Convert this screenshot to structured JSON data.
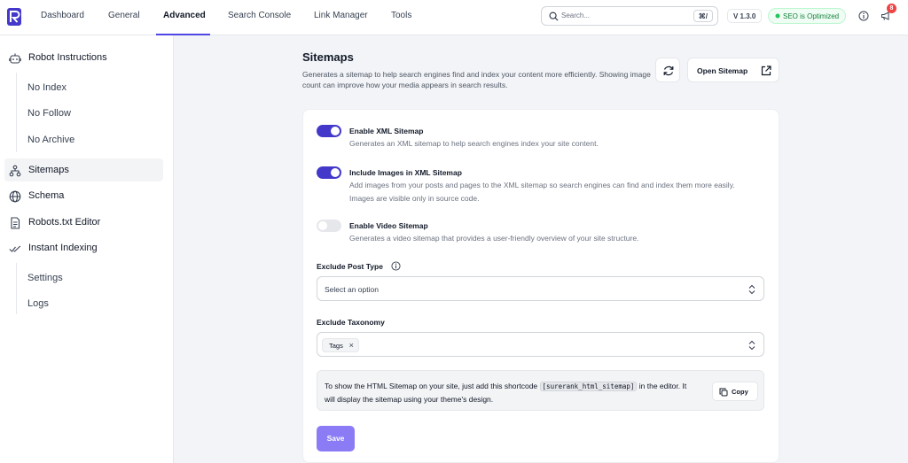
{
  "nav": {
    "items": [
      {
        "label": "Dashboard"
      },
      {
        "label": "General"
      },
      {
        "label": "Advanced"
      },
      {
        "label": "Search Console"
      },
      {
        "label": "Link Manager"
      },
      {
        "label": "Tools"
      }
    ],
    "active": "Advanced"
  },
  "topbar": {
    "search_placeholder": "Search...",
    "shortcut": "⌘/",
    "version": "V 1.3.0",
    "seo_status": "SEO is Optimized",
    "notification_count": "8"
  },
  "sidebar": {
    "robot_instructions": "Robot Instructions",
    "no_index": "No Index",
    "no_follow": "No Follow",
    "no_archive": "No Archive",
    "sitemaps": "Sitemaps",
    "schema": "Schema",
    "robots_editor": "Robots.txt Editor",
    "instant_indexing": "Instant Indexing",
    "settings": "Settings",
    "logs": "Logs"
  },
  "page": {
    "title": "Sitemaps",
    "description": "Generates a sitemap to help search engines find and index your content more efficiently. Showing image count can improve how your media appears in search results.",
    "open_sitemap": "Open Sitemap"
  },
  "settings": {
    "xml": {
      "label": "Enable XML Sitemap",
      "desc": "Generates an XML sitemap to help search engines index your site content.",
      "enabled": true
    },
    "images": {
      "label": "Include Images in XML Sitemap",
      "desc": "Add images from your posts and pages to the XML sitemap so search engines can find and index them more easily. Images are visible only in source code.",
      "enabled": true
    },
    "video": {
      "label": "Enable Video Sitemap",
      "desc": "Generates a video sitemap that provides a user-friendly overview of your site structure.",
      "enabled": false
    },
    "exclude_post_type": {
      "label": "Exclude Post Type",
      "value": "Select an option"
    },
    "exclude_taxonomy": {
      "label": "Exclude Taxonomy",
      "tags": [
        "Tags"
      ]
    }
  },
  "note": {
    "text_before": "To show the HTML Sitemap on your site, just add this shortcode",
    "shortcode": "[surerank_html_sitemap]",
    "text_after": "in the editor. It will display the sitemap using your theme's design.",
    "copy": "Copy"
  },
  "save": "Save",
  "colors": {
    "accent": "#4338ca",
    "save": "#8b7cf6",
    "success": "#15803d"
  }
}
